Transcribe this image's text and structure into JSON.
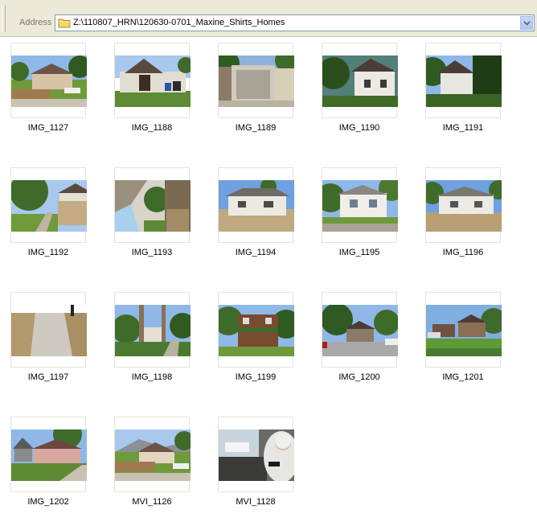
{
  "address_bar": {
    "label": "Address",
    "path": "Z:\\110807_HRN\\120630-0701_Maxine_Shirts_Homes",
    "folder_icon": "folder-icon",
    "dropdown_icon": "chevron-down-icon"
  },
  "files": [
    {
      "name": "IMG_1127"
    },
    {
      "name": "IMG_1188"
    },
    {
      "name": "IMG_1189"
    },
    {
      "name": "IMG_1190"
    },
    {
      "name": "IMG_1191"
    },
    {
      "name": "IMG_1192"
    },
    {
      "name": "IMG_1193"
    },
    {
      "name": "IMG_1194"
    },
    {
      "name": "IMG_1195"
    },
    {
      "name": "IMG_1196"
    },
    {
      "name": "IMG_1197"
    },
    {
      "name": "IMG_1198"
    },
    {
      "name": "IMG_1199"
    },
    {
      "name": "IMG_1200"
    },
    {
      "name": "IMG_1201"
    },
    {
      "name": "IMG_1202"
    },
    {
      "name": "MVI_1126"
    },
    {
      "name": "MVI_1128"
    }
  ],
  "colors": {
    "sky": "#8fb8e8",
    "foliage": "#3f6b2a",
    "lawn": "#6f9a3c",
    "dry_grass": "#b8a47a",
    "house_white": "#e8e6e0",
    "roof": "#5a4a3e"
  }
}
